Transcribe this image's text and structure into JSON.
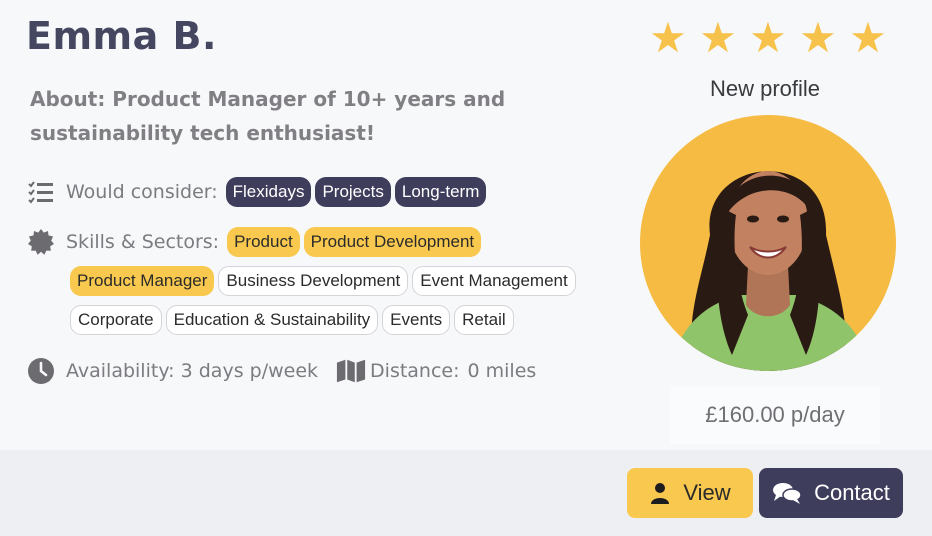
{
  "profile": {
    "name": "Emma B.",
    "about": "About: Product Manager of 10+ years and sustainability tech enthusiast!",
    "status": "New profile",
    "price": "£160.00 p/day",
    "rating": 5
  },
  "would_consider": {
    "label": "Would consider:",
    "icon": "checklist-icon",
    "tags": [
      "Flexidays",
      "Projects",
      "Long-term"
    ]
  },
  "skills": {
    "label": "Skills & Sectors:",
    "icon": "badge-icon",
    "tags": [
      {
        "label": "Product",
        "style": "highlight"
      },
      {
        "label": "Product Development",
        "style": "highlight"
      },
      {
        "label": "Product Manager",
        "style": "highlight"
      },
      {
        "label": "Business Development",
        "style": "plain"
      },
      {
        "label": "Event Management",
        "style": "plain"
      },
      {
        "label": "Corporate",
        "style": "plain"
      },
      {
        "label": "Education & Sustainability",
        "style": "plain"
      },
      {
        "label": "Events",
        "style": "plain"
      },
      {
        "label": "Retail",
        "style": "plain"
      }
    ]
  },
  "availability": {
    "label": "Availability: 3 days p/week",
    "icon": "clock-icon"
  },
  "distance": {
    "label": "Distance:",
    "value": "0 miles",
    "icon": "map-icon"
  },
  "actions": {
    "view": "View",
    "contact": "Contact"
  },
  "colors": {
    "accent_yellow": "#f8c94e",
    "dark_navy": "#3f3d5c",
    "star": "#f6c24b"
  }
}
